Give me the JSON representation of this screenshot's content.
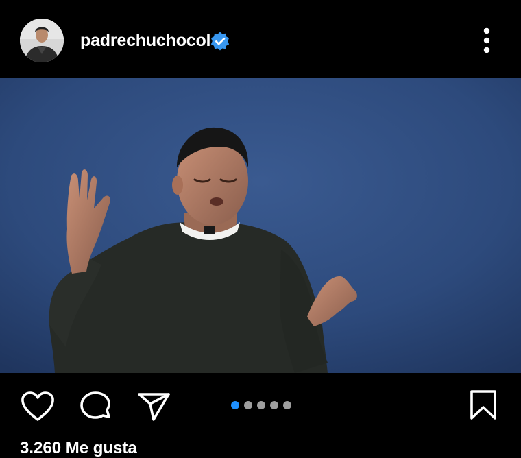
{
  "header": {
    "username": "padrechuchocol",
    "verified": true,
    "avatar_icon": "profile-photo",
    "menu_icon": "more-vertical-icon"
  },
  "post": {
    "image_description": "priest-with-raised-hands-photo",
    "carousel": {
      "total": 5,
      "active_index": 0
    }
  },
  "actions": {
    "icons": [
      "heart-icon",
      "comment-icon",
      "share-icon",
      "bookmark-icon"
    ]
  },
  "likes": {
    "text": "3.260 Me gusta"
  },
  "colors": {
    "background": "#000000",
    "verified_badge": "#3897f0",
    "active_dot": "#1e90ff",
    "inactive_dot": "#9e9e9e",
    "photo_backdrop": "#2c4878"
  }
}
